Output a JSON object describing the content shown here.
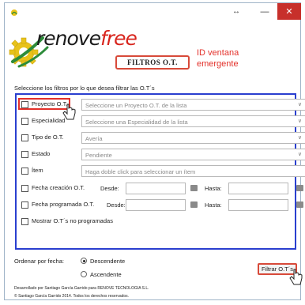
{
  "titlebar": {
    "resize_glyph": "↔",
    "minimize_glyph": "—",
    "maximize_glyph": "☐",
    "close_glyph": "✕"
  },
  "logo": {
    "part1": "renove",
    "part2": "free"
  },
  "header": {
    "filters_title": "FILTROS O.T.",
    "annotation": "ID ventana emergente"
  },
  "filters": {
    "intro": "Seleccione los filtros por lo que desea filtrar las O.T´s",
    "proyecto": {
      "label": "Proyecto O.T.",
      "placeholder": "Seleccione un Proyecto O.T. de la lista"
    },
    "especialidad": {
      "label": "Especialidad",
      "placeholder": "Seleccione una Especialidad de la lista"
    },
    "tipo": {
      "label": "Tipo de O.T.",
      "value": "Avería"
    },
    "estado": {
      "label": "Estado",
      "value": "Pendiente"
    },
    "item": {
      "label": "Ítem",
      "placeholder": "Haga doble click para seleccionar un ítem"
    },
    "fecha_creacion": {
      "label": "Fecha creación O.T.",
      "from": "Desde:",
      "to": "Hasta:"
    },
    "fecha_programada": {
      "label": "Fecha programada O.T.",
      "from": "Desde:",
      "to": "Hasta:"
    },
    "no_programadas": {
      "label": "Mostrar O.T´s no programadas"
    }
  },
  "order": {
    "label": "Ordenar por fecha:",
    "options": [
      "Descendente",
      "Ascendente"
    ],
    "selected": "Descendente"
  },
  "buttons": {
    "filter": "Filtrar O.T´s"
  },
  "footer": {
    "line1": "Desarrollado por Santiago García Garrido para RENOVE TECNOLOGIA S.L.",
    "line2": "© Santiago García Garrido 2014. Todos los derechos reservados."
  },
  "colors": {
    "accent_red": "#e3302a",
    "panel_border_blue": "#2a3fcf",
    "close_button": "#c7302b",
    "logo_yellow": "#e8c21a"
  },
  "icons": [
    "app-icon",
    "logo-gear-icon",
    "pointer-cursor-icon",
    "calendar-icon",
    "dropdown-arrow-icon"
  ]
}
